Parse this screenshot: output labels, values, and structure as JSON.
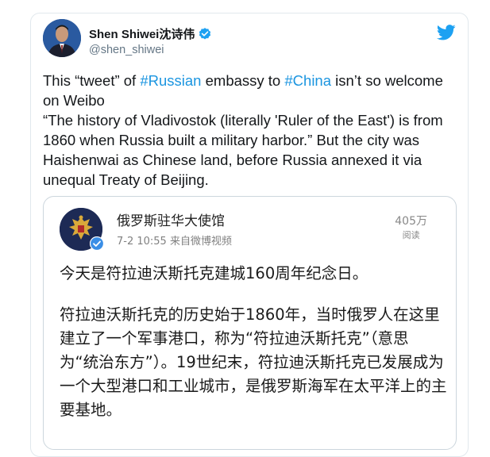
{
  "tweet": {
    "author": {
      "name": "Shen Shiwei沈诗伟",
      "handle": "@shen_shiwei",
      "verified": true
    },
    "text": {
      "line1_pre": "This “tweet” of ",
      "hashtag1": "#Russian",
      "line1_mid": " embassy to ",
      "hashtag2": "#China",
      "line1_post": " isn’t so welcome on Weibo",
      "para2": "“The history of Vladivostok (literally 'Ruler of the East') is from 1860 when Russia built a military harbor.” But the city was Haishenwai as Chinese land, before Russia annexed it via unequal Treaty of Beijing."
    },
    "icons": {
      "verified": "verified-badge-icon",
      "twitter": "twitter-bird-icon"
    },
    "colors": {
      "hashtag": "#1b95e0",
      "twitter_blue": "#1da1f2"
    }
  },
  "quoted_post": {
    "account_name": "俄罗斯驻华大使馆",
    "meta": "7-2 10:55  来自微博视频",
    "views_count": "405万",
    "views_label": "阅读",
    "paragraph1": "今天是符拉迪沃斯托克建城160周年纪念日。",
    "paragraph2": "符拉迪沃斯托克的历史始于1860年，当时俄罗人在这里建立了一个军事港口，称为“符拉迪沃斯托克”（意思为“统治东方”）。19世纪末，符拉迪沃斯托克已发展成为一个大型港口和工业城市，是俄罗斯海军在太平洋上的主要基地。"
  }
}
